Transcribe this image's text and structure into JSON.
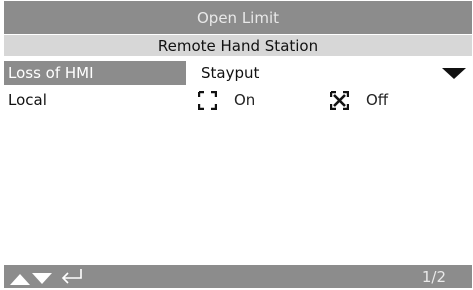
{
  "header": {
    "title": "Open Limit",
    "subtitle": "Remote Hand Station"
  },
  "settings": [
    {
      "label": "Loss of HMI",
      "value": "Stayput",
      "selected": true,
      "icon": "chevron-down-icon"
    },
    {
      "label": "Local",
      "options": [
        {
          "label": "On",
          "checked": false
        },
        {
          "label": "Off",
          "checked": true
        }
      ]
    }
  ],
  "footer": {
    "icons": [
      "up-arrow-icon",
      "down-arrow-icon",
      "enter-icon"
    ],
    "page": "1/2"
  },
  "colors": {
    "bar": "#8c8c8c",
    "subtitle_bar": "#d7d7d7",
    "bar_text": "#e9e9e9",
    "text": "#111111"
  }
}
